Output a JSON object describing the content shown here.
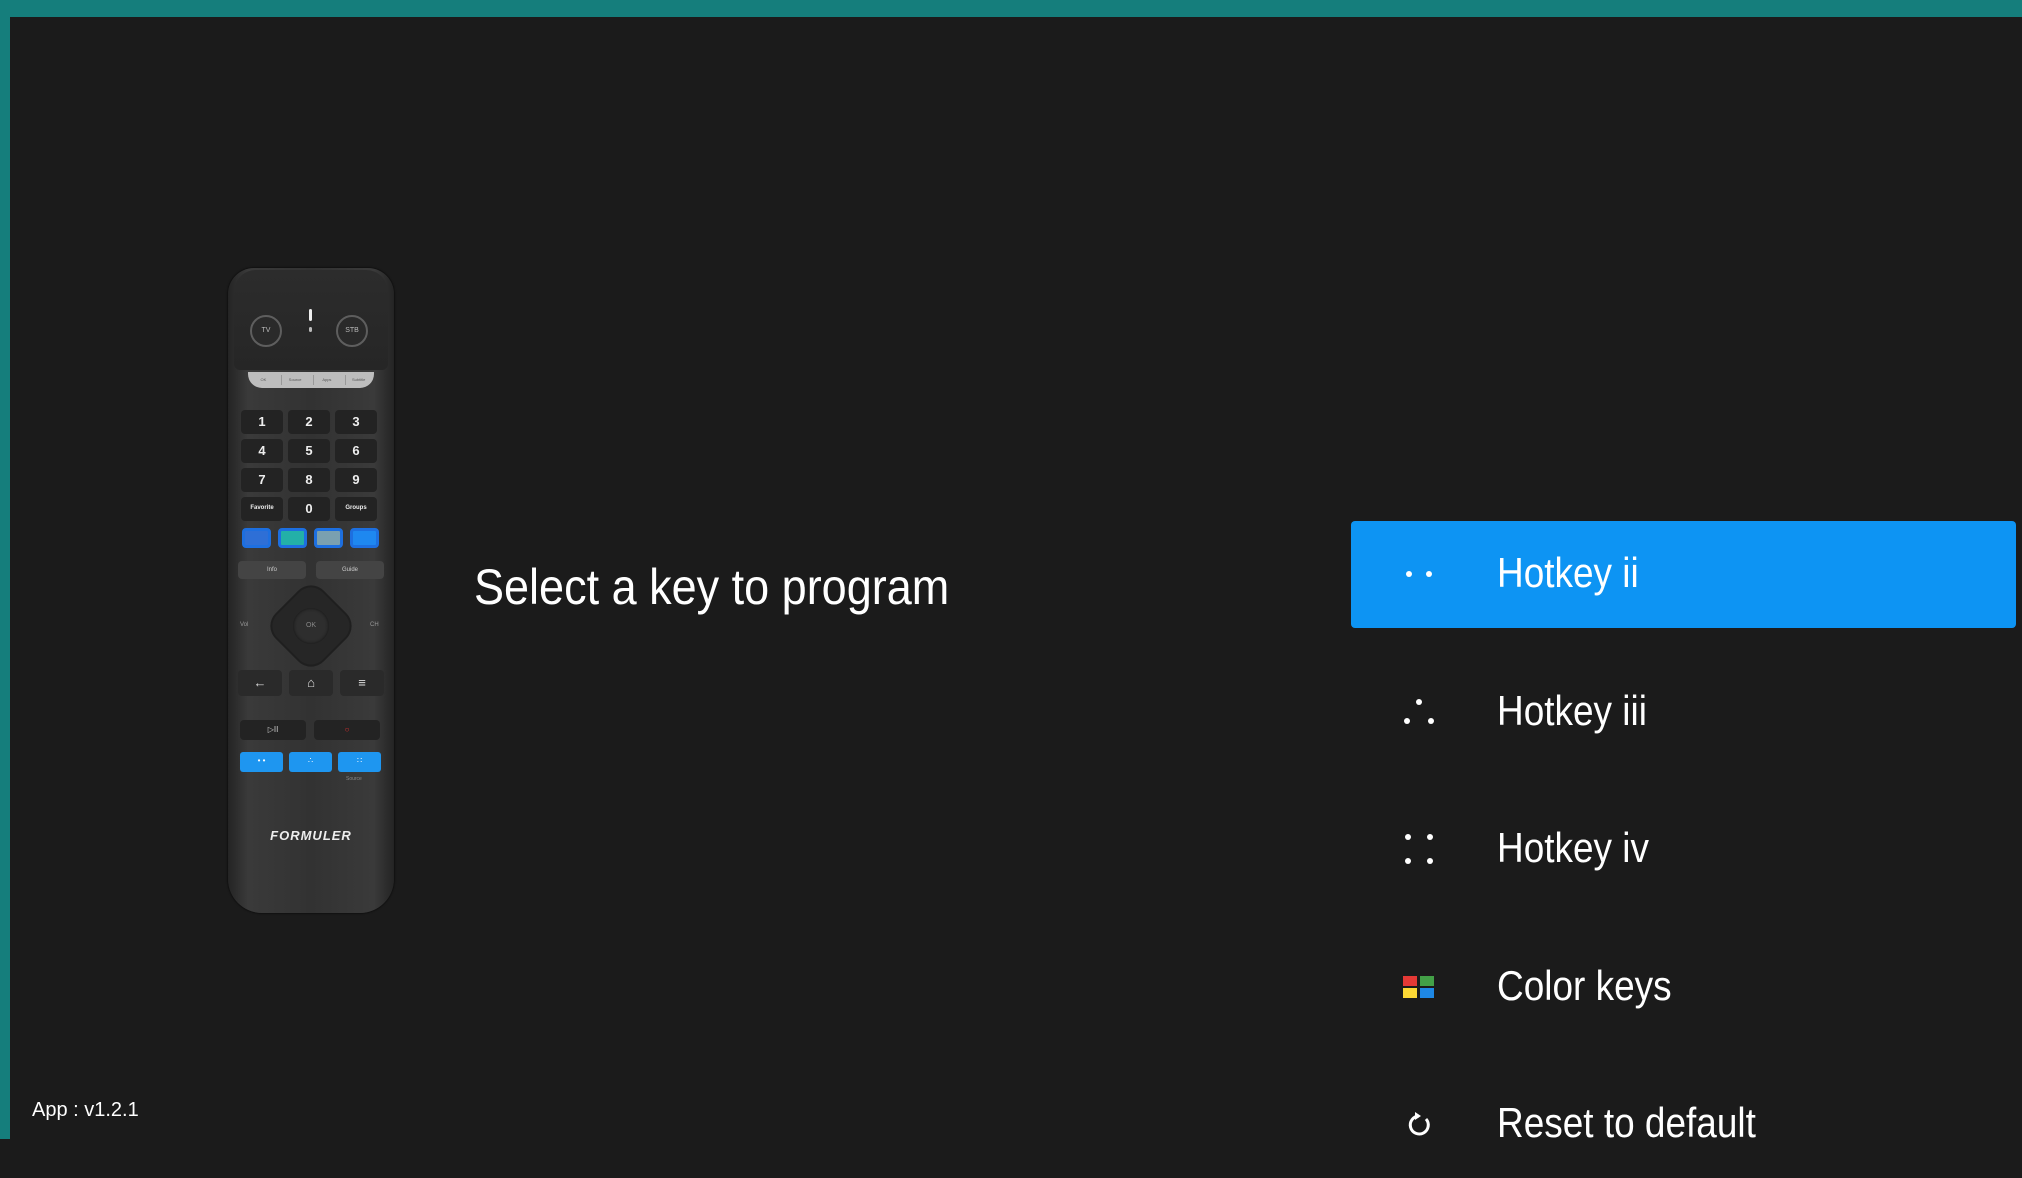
{
  "remote": {
    "top_buttons": {
      "left": "TV",
      "right": "STB"
    },
    "silver_keys": [
      "OK",
      "Source",
      "Apps",
      "Subtitle"
    ],
    "numpad": [
      "1",
      "2",
      "3",
      "4",
      "5",
      "6",
      "7",
      "8",
      "9",
      "Favorite",
      "0",
      "Groups"
    ],
    "info_left": "Info",
    "info_right": "Guide",
    "ok_label": "OK",
    "vol_label": "Vol",
    "ch_label": "CH",
    "nav_back": "←",
    "nav_home": "⌂",
    "nav_menu": "≡",
    "play_pause": "▷II",
    "record": "○",
    "source_label": "Source",
    "brand": "FORMULER",
    "color_keys": [
      "#d32f2f",
      "#2eb84c",
      "#e6b400",
      "#1d6fe0"
    ],
    "hotkey_color": "#1e96f0"
  },
  "prompt": "Select a key to program",
  "menu": {
    "items": [
      {
        "label": "Hotkey ii",
        "icon": "two-dots-icon",
        "selected": true
      },
      {
        "label": "Hotkey iii",
        "icon": "three-dots-icon",
        "selected": false
      },
      {
        "label": "Hotkey iv",
        "icon": "four-dots-icon",
        "selected": false
      },
      {
        "label": "Color keys",
        "icon": "color-keys-icon",
        "selected": false
      },
      {
        "label": "Reset to default",
        "icon": "reset-icon",
        "selected": false
      }
    ],
    "color_icon_colors": [
      "#e53935",
      "#43a047",
      "#fdd835",
      "#1e88e5"
    ],
    "selected_color": "#0d94f3"
  },
  "version": "App : v1.2.1",
  "colors": {
    "background": "#1b1b1b",
    "frame": "#157e7c",
    "text": "#ffffff"
  }
}
